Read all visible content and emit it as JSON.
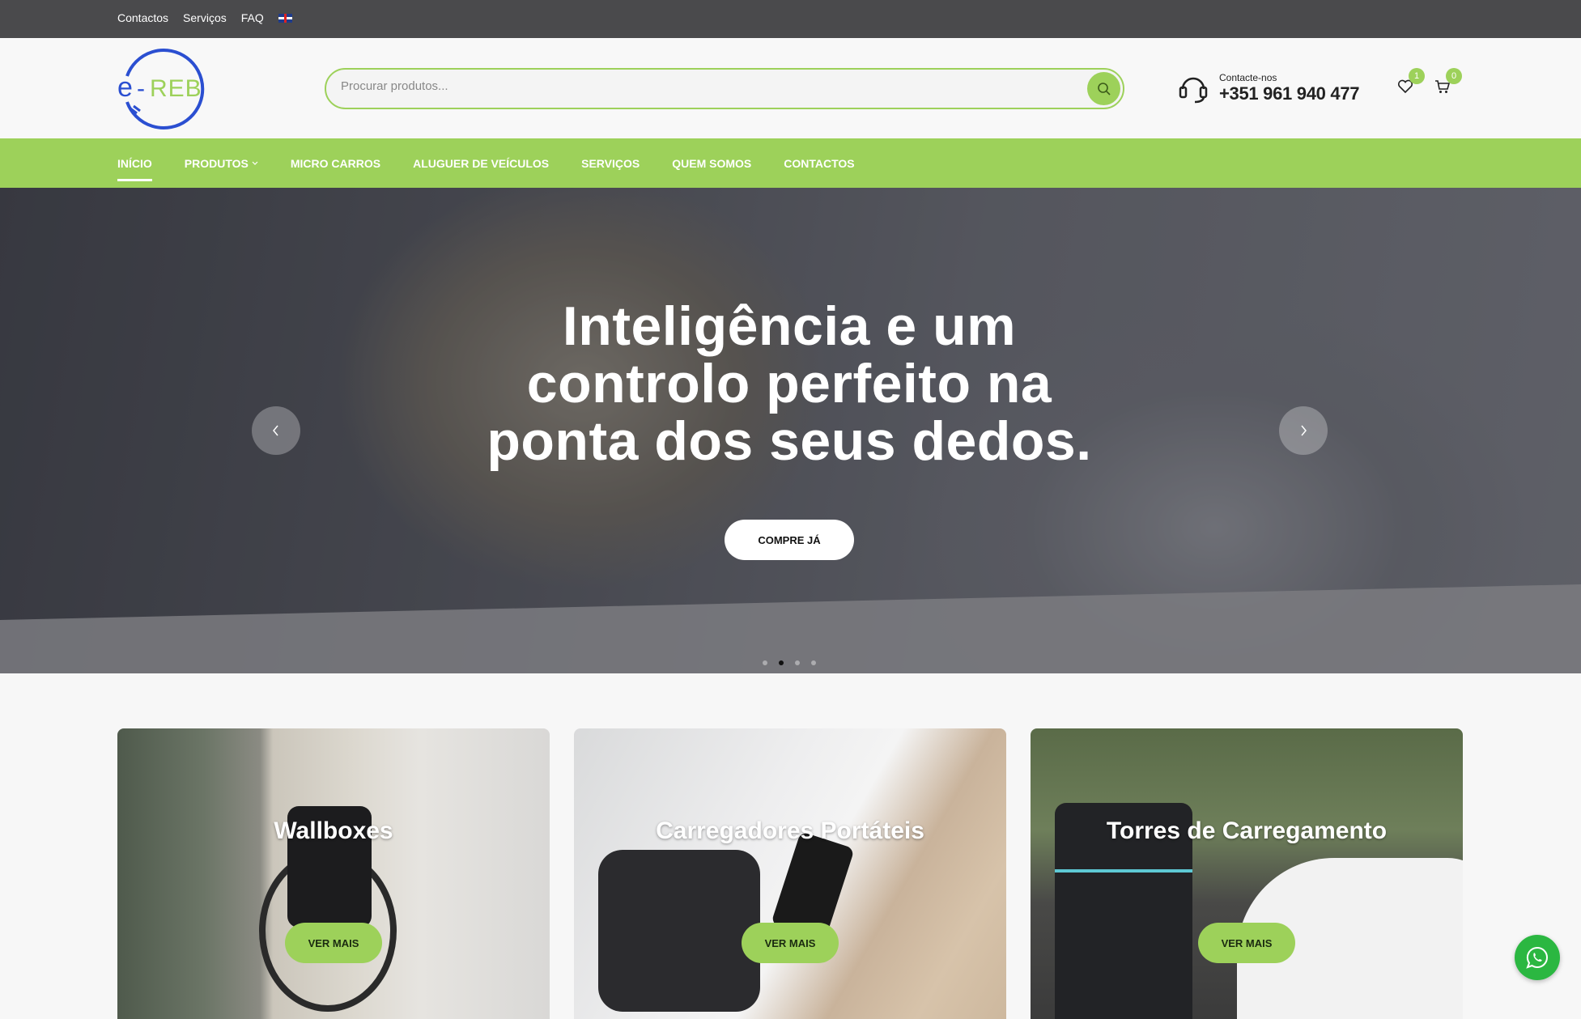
{
  "topbar": {
    "links": [
      "Contactos",
      "Serviços",
      "FAQ"
    ],
    "language_icon": "uk-flag-icon"
  },
  "header": {
    "logo_text": "e-REB",
    "search": {
      "placeholder": "Procurar produtos..."
    },
    "contact_label": "Contacte-nos",
    "phone": "+351 961 940 477",
    "wishlist_count": "1",
    "cart_count": "0"
  },
  "nav": {
    "items": [
      "INÍCIO",
      "PRODUTOS",
      "MICRO CARROS",
      "ALUGUER DE VEÍCULOS",
      "SERVIÇOS",
      "QUEM SOMOS",
      "CONTACTOS"
    ],
    "active": "INÍCIO"
  },
  "hero": {
    "headline": "Inteligência e um controlo perfeito na ponta dos seus dedos.",
    "cta": "COMPRE JÁ",
    "slide_count": 4,
    "active_slide": 2
  },
  "categories": [
    {
      "title": "Wallboxes",
      "button": "VER MAIS"
    },
    {
      "title": "Carregadores Portáteis",
      "button": "VER MAIS"
    },
    {
      "title": "Torres de Carregamento",
      "button": "VER MAIS"
    }
  ],
  "colors": {
    "accent": "#9dd15a",
    "topbar": "#4a4a4c",
    "logo_blue": "#2b4fd1",
    "whatsapp": "#2bb741"
  }
}
